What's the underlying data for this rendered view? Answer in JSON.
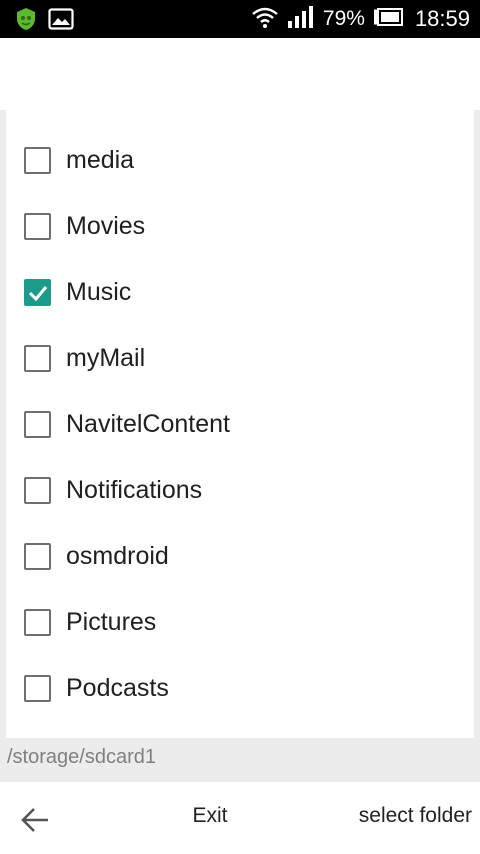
{
  "status_bar": {
    "battery_percent": "79%",
    "time": "18:59",
    "icons": [
      "app-shield-icon",
      "image-icon",
      "wifi-icon",
      "signal-icon",
      "battery-icon"
    ]
  },
  "folder_list": {
    "items": [
      {
        "label": "media",
        "checked": false
      },
      {
        "label": "Movies",
        "checked": false
      },
      {
        "label": "Music",
        "checked": true
      },
      {
        "label": "myMail",
        "checked": false
      },
      {
        "label": "NavitelContent",
        "checked": false
      },
      {
        "label": "Notifications",
        "checked": false
      },
      {
        "label": "osmdroid",
        "checked": false
      },
      {
        "label": "Pictures",
        "checked": false
      },
      {
        "label": "Podcasts",
        "checked": false
      }
    ]
  },
  "current_path": "/storage/sdcard1",
  "bottom_bar": {
    "exit_label": "Exit",
    "select_folder_label": "select folder"
  },
  "colors": {
    "accent": "#1d9b8a",
    "checkbox_border": "#6f6f6f",
    "path_text": "#808080"
  }
}
